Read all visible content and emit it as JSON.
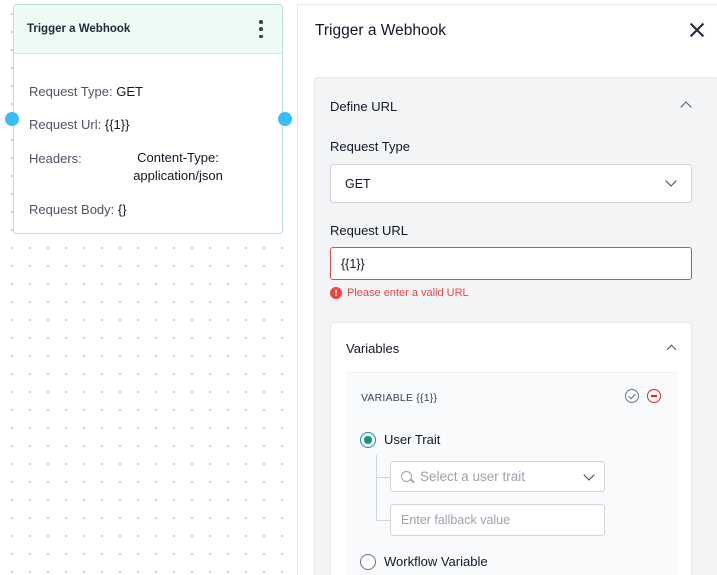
{
  "node": {
    "title": "Trigger a Webhook",
    "request_type_label": "Request Type:",
    "request_type_value": "GET",
    "request_url_label": "Request Url:",
    "request_url_value": "{{1}}",
    "headers_label": "Headers:",
    "headers_value_line1": "Content-Type:",
    "headers_value_line2": "application/json",
    "request_body_label": "Request Body:",
    "request_body_value": "{}"
  },
  "panel": {
    "title": "Trigger a Webhook",
    "define_url": {
      "title": "Define URL",
      "request_type_label": "Request Type",
      "request_type_value": "GET",
      "request_url_label": "Request URL",
      "request_url_value": "{{1}}",
      "error_message": "Please enter a valid URL"
    },
    "variables": {
      "title": "Variables",
      "variable_label": "VARIABLE {{1}}",
      "user_trait_label": "User Trait",
      "user_trait_placeholder": "Select a user trait",
      "fallback_placeholder": "Enter fallback value",
      "workflow_variable_label": "Workflow Variable"
    }
  },
  "colors": {
    "accent": "#0d9488",
    "error": "#ef4444",
    "handle": "#38bdf8"
  }
}
